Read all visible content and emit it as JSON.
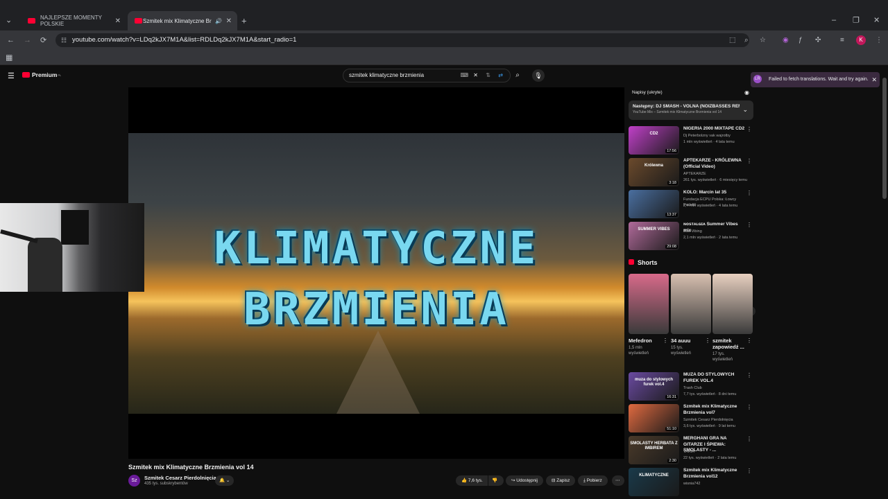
{
  "browser": {
    "tabs": [
      {
        "title": "NAJLEPSZE MOMENTY POLSKIE",
        "active": false
      },
      {
        "title": "Szmitek mix Klimatyczne Br",
        "active": true
      }
    ],
    "url": "youtube.com/watch?v=LDq2kJX7M1A&list=RDLDq2kJX7M1A&start_radio=1",
    "profile_initial": "K"
  },
  "youtube": {
    "logo_text": "Premium",
    "logo_badge": "PL",
    "search_value": "szmitek klimatyczne brzmienia",
    "toast": "Failed to fetch translations. Wait and try again."
  },
  "video": {
    "overlay_line1": "KLIMATYCZNE",
    "overlay_line2": "BRZMIENIA",
    "title": "Szmitek mix Klimatyczne Brzmienia vol 14",
    "channel_avatar": "Sz",
    "channel_name": "Szmitek Cesarz Pierdolnięcia",
    "subscribers": "435 tys. subskrybentów",
    "like_count": "7,6 tys.",
    "share_label": "Udostępnij",
    "save_label": "Zapisz",
    "download_label": "Pobierz"
  },
  "sidebar": {
    "captions_label": "Napisy (ukryte)",
    "next_label": "Następny: DJ SMASH - VOLNA (NOIZBASSES REMI...",
    "next_sub": "YouTube Mix – Szmitek mix Klimatyczne Brzmienia vol 14",
    "recs_top": [
      {
        "title": "NIGERIA 2000 MIXTAPE CD2",
        "channel": "Dj Peterbolzny vak wajrotby",
        "meta": "1 mln wyświetleń · 4 lata temu",
        "duration": "17:56",
        "thumb": "#c040c8",
        "caption": "CD2"
      },
      {
        "title": "APTEKARZE - KRÓLEWNA (Official Video)",
        "channel": "APTEKARZE",
        "meta": "261 tys. wyświetleń · 6 miesięcy temu",
        "duration": "3:18",
        "thumb": "#6b4a2c",
        "caption": "Królewna"
      },
      {
        "title": "KOLO: Marcin lat 35",
        "channel": "Fundacja ECPU Polska: Łowcy Pedofili",
        "meta": "2,4 mln wyświetleń · 4 lata temu",
        "duration": "13:37",
        "thumb": "#4a6fa0",
        "caption": ""
      },
      {
        "title": "ɴᴏsᴛᴀʟɢɪᴀ Summer Vibes mix",
        "channel": "Just Vibing",
        "meta": "2,1 mln wyświetleń · 2 lata temu",
        "duration": "29:08",
        "thumb": "#b06a9a",
        "caption": "SUMMER VIBES"
      }
    ],
    "shorts_heading": "Shorts",
    "shorts": [
      {
        "title": "Mefedron",
        "meta1": "1,5 mln",
        "meta2": "wyświetleń",
        "meta3": "",
        "thumb": "#d86a8a"
      },
      {
        "title": "34 auuu",
        "meta1": "15 tys.",
        "meta2": "wyświetleń",
        "meta3": "",
        "thumb": "#d8c0b0"
      },
      {
        "title": "szmitek zapowiedź ...",
        "meta1": "17 tys.",
        "meta2": "wyświetleń",
        "meta3": "",
        "thumb": "#e8d0c0"
      }
    ],
    "recs_bottom": [
      {
        "title": "MUZA DO STYLOWYCH FUREK VOL.4",
        "channel": "Trash Club",
        "meta": "7,7 tys. wyświetleń · 8 dni temu",
        "duration": "16:31",
        "thumb": "#6a4aa0",
        "caption": "muza do stylowych furek vol.4"
      },
      {
        "title": "Szmitek mix Klimatyczne Brzmienia vol7",
        "channel": "Szmitek Cesarz Pierdolnięcia",
        "meta": "3,6 tys. wyświetleń · 9 lat temu",
        "duration": "51:10",
        "thumb": "#e06a40",
        "caption": ""
      },
      {
        "title": "MERGHANI GRA NA GITARZE I ŚPIEWA: SMOLASTY - ...",
        "channel": "VARIA",
        "meta": "22 tys. wyświetleń · 2 lata temu",
        "duration": "2:30",
        "thumb": "#4a3a2a",
        "caption": "SMOLASTY HERBATA Z IMBIREM"
      },
      {
        "title": "Szmitek mix Klimatyczne Brzmienia vol12",
        "channel": "wisnia742",
        "meta": "",
        "duration": "",
        "thumb": "#1a3a4a",
        "caption": "KLIMATYCZNE"
      }
    ]
  }
}
